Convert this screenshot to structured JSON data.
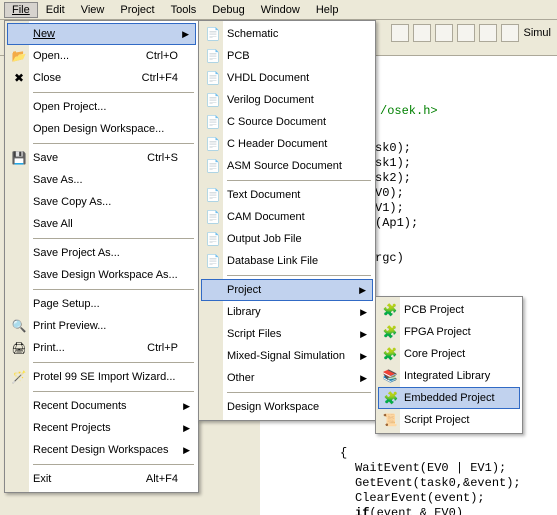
{
  "menubar": {
    "file": "File",
    "edit": "Edit",
    "view": "View",
    "project": "Project",
    "tools": "Tools",
    "debug": "Debug",
    "window": "Window",
    "help": "Help"
  },
  "toolbar_right_label": "Simul",
  "file_menu": {
    "new": "New",
    "open": "Open...",
    "open_sc": "Ctrl+O",
    "close": "Close",
    "close_sc": "Ctrl+F4",
    "open_project": "Open Project...",
    "open_design_ws": "Open Design Workspace...",
    "save": "Save",
    "save_sc": "Ctrl+S",
    "save_as": "Save As...",
    "save_copy_as": "Save Copy As...",
    "save_all": "Save All",
    "save_project_as": "Save Project As...",
    "save_design_ws_as": "Save Design Workspace As...",
    "page_setup": "Page Setup...",
    "print_preview": "Print Preview...",
    "print": "Print...",
    "print_sc": "Ctrl+P",
    "protel99": "Protel 99 SE Import Wizard...",
    "recent_docs": "Recent Documents",
    "recent_projects": "Recent Projects",
    "recent_design_ws": "Recent Design Workspaces",
    "exit": "Exit",
    "exit_sc": "Alt+F4"
  },
  "new_menu": {
    "schematic": "Schematic",
    "pcb": "PCB",
    "vhdl": "VHDL Document",
    "verilog": "Verilog Document",
    "csource": "C Source Document",
    "cheader": "C Header Document",
    "asm": "ASM Source Document",
    "text": "Text Document",
    "cam": "CAM Document",
    "output_job": "Output Job File",
    "dblink": "Database Link File",
    "project": "Project",
    "library": "Library",
    "script_files": "Script Files",
    "mixed_signal": "Mixed-Signal Simulation",
    "other": "Other",
    "design_ws": "Design Workspace"
  },
  "project_menu": {
    "pcb_project": "PCB Project",
    "fpga_project": "FPGA Project",
    "core_project": "Core Project",
    "integrated_library": "Integrated Library",
    "embedded_project": "Embedded Project",
    "script_project": "Script Project"
  },
  "code": {
    "include_tail": "/osek.h>",
    "l1": "sk0);",
    "l2": "sk1);",
    "l3": "sk2);",
    "l4": "V0);",
    "l5": "V1);",
    "l6": "(Ap1);",
    "l7": "rgc)",
    "brace_open": "{",
    "c1": "WaitEvent(EV0 | EV1);",
    "c2": "GetEvent(task0,&event);",
    "c3": "ClearEvent(event);",
    "c4": "if(event & EV0)"
  }
}
